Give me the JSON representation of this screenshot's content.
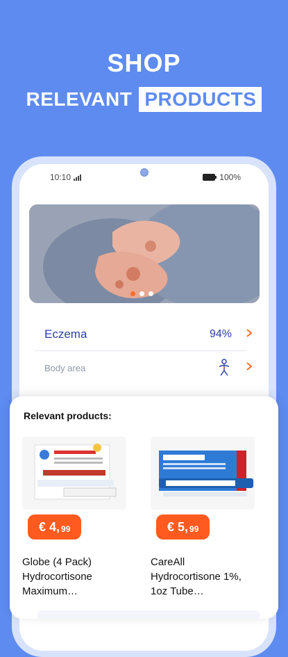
{
  "header": {
    "line1": "SHOP",
    "line2_left": "RELEVANT",
    "line2_highlight": "PRODUCTS"
  },
  "status_bar": {
    "time": "10:10",
    "battery": "100%"
  },
  "carousel": {
    "active_index": 0,
    "count": 3
  },
  "condition": {
    "name": "Eczema",
    "percentage": "94%"
  },
  "body_area": {
    "label": "Body area",
    "icon": "person-body-icon"
  },
  "products": {
    "title": "Relevant products:",
    "items": [
      {
        "price_main": "€ 4,",
        "price_cents": "99",
        "name": "Globe (4 Pack) Hydrocortisone Maximum…",
        "image_icon": "hydrocortisone-cream-box"
      },
      {
        "price_main": "€ 5,",
        "price_cents": "99",
        "name": "CareAll Hydrocortisone 1%, 1oz Tube…",
        "image_icon": "anti-itch-cream-box"
      }
    ]
  },
  "colors": {
    "background": "#5E8BF0",
    "accent": "#FF5A1F",
    "condition_text": "#2B3FA8"
  }
}
